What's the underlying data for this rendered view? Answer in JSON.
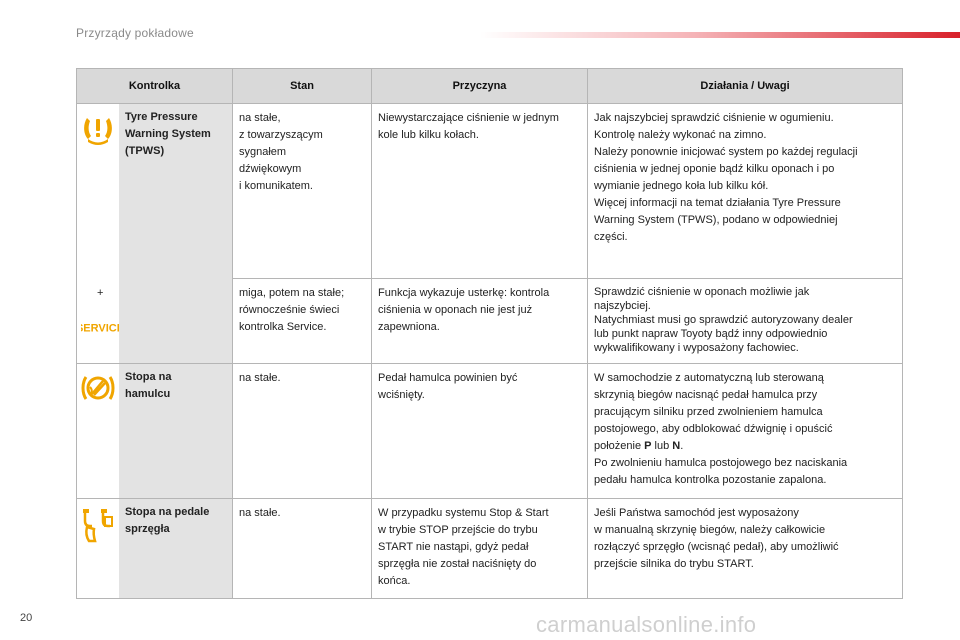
{
  "header": {
    "section_title": "Przyrządy pokładowe"
  },
  "table": {
    "columns": [
      "Kontrolka",
      "Stan",
      "Przyczyna",
      "Działania / Uwagi"
    ],
    "rows": [
      {
        "icon": "tpms-warning-icon",
        "name_lines": [
          "Tyre Pressure",
          "Warning System",
          "(TPWS)"
        ],
        "plus": "+",
        "service_icon": "SERVICE",
        "states": [
          {
            "state_lines": [
              "na stałe,",
              "z towarzyszącym",
              "sygnałem",
              "dźwiękowym",
              "i komunikatem."
            ],
            "cause_lines": [
              "Niewystarczające ciśnienie w jednym",
              "kole lub kilku kołach."
            ],
            "action_lines": [
              "Jak najszybciej sprawdzić ciśnienie w ogumieniu.",
              "Kontrolę należy wykonać na zimno.",
              "Należy ponownie inicjować system po każdej regulacji",
              "ciśnienia w jednej oponie bądź kilku oponach i po",
              "wymianie jednego koła lub kilku kół.",
              "Więcej informacji na temat działania Tyre Pressure",
              "Warning System (TPWS), podano w odpowiedniej",
              "części."
            ]
          },
          {
            "state_lines": [
              "miga, potem na stałe;",
              "równocześnie świeci",
              "kontrolka Service."
            ],
            "cause_lines": [
              "Funkcja wykazuje usterkę: kontrola",
              "ciśnienia w oponach nie jest już",
              "zapewniona."
            ],
            "action_lines": [
              "Sprawdzić ciśnienie w oponach możliwie jak",
              "najszybciej.",
              "Natychmiast musi go sprawdzić autoryzowany dealer",
              "lub punkt napraw Toyoty bądź inny odpowiednio",
              "wykwalifikowany i wyposażony fachowiec."
            ]
          }
        ]
      },
      {
        "icon": "brake-pedal-icon",
        "name_lines": [
          "Stopa na",
          "hamulcu"
        ],
        "state_lines": [
          "na stałe."
        ],
        "cause_lines": [
          "Pedał hamulca powinien być",
          "wciśnięty."
        ],
        "action_lines": [
          "W samochodzie z automatyczną lub sterowaną",
          "skrzynią biegów nacisnąć pedał hamulca przy",
          "pracującym silniku przed zwolnieniem hamulca",
          "postojowego, aby odblokować dźwignię i opuścić"
        ],
        "action_pos_pre": "położenie ",
        "action_pos_p": "P",
        "action_pos_mid": " lub ",
        "action_pos_n": "N",
        "action_pos_end": ".",
        "action_tail_lines": [
          "Po zwolnieniu hamulca postojowego bez naciskania",
          "pedału hamulca kontrolka pozostanie zapalona."
        ]
      },
      {
        "icon": "clutch-pedal-icon",
        "name_lines": [
          "Stopa na pedale",
          "sprzęgła"
        ],
        "state_lines": [
          "na stałe."
        ],
        "cause_lines": [
          "W przypadku systemu Stop & Start",
          "w trybie STOP przejście do trybu",
          "START nie nastąpi, gdyż pedał",
          "sprzęgła nie został naciśnięty do",
          "końca."
        ],
        "action_lines": [
          "Jeśli Państwa samochód jest wyposażony",
          "w manualną skrzynię biegów, należy całkowicie",
          "rozłączyć sprzęgło (wcisnąć pedał), aby umożliwić",
          "przejście silnika do trybu START."
        ]
      }
    ]
  },
  "footer": {
    "page_number": "20",
    "watermark": "carmanualsonline.info"
  },
  "colors": {
    "accent": "#d8202a",
    "icon_amber": "#f0a500",
    "header_bg": "#d9d9d9",
    "name_bg": "#e3e3e3"
  }
}
